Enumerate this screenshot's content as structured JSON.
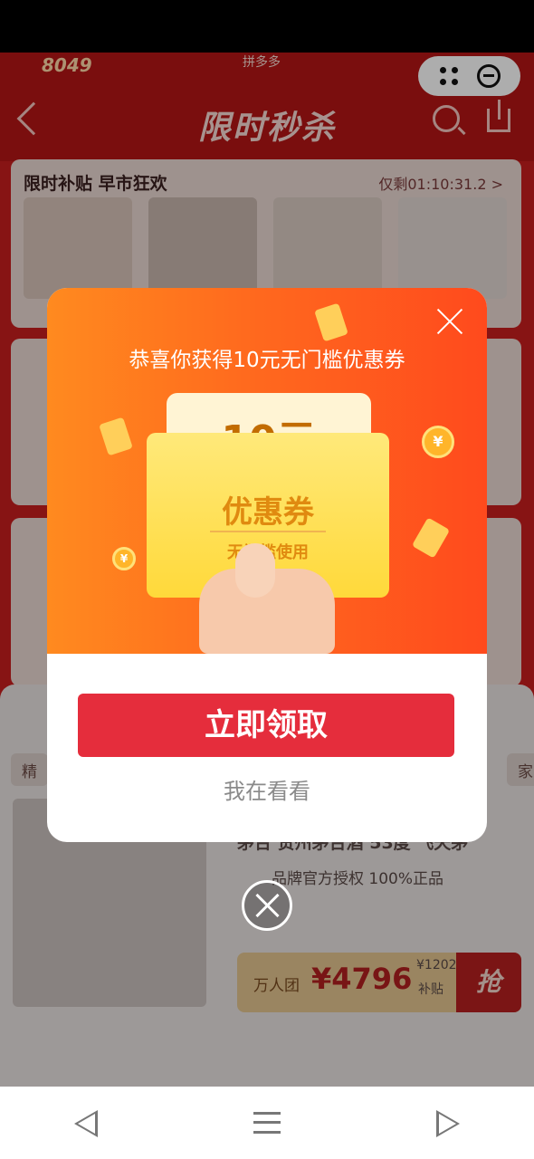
{
  "header": {
    "brand_mini": "8049",
    "app_name": "拼多多",
    "title": "限时秒杀"
  },
  "flash_sale": {
    "title": "限时补贴  早市狂欢",
    "countdown": "仅剩01:10:31.2 >"
  },
  "category_tabs": [
    "精",
    "家"
  ],
  "featured_product": {
    "title": "茅台 贵州茅台酒 53度 飞天茅",
    "tag": "品牌官方授权  100%正品",
    "price_label": "万人团",
    "price": "¥4796",
    "original_price": "¥1202",
    "subsidy": "补贴",
    "grab_label": "抢"
  },
  "modal": {
    "heading": "恭喜你获得10元无门槛优惠券",
    "coupon_amount": "10元",
    "coupon_label": "优惠券",
    "coupon_sub": "无门槛使用",
    "claim_button": "立即领取",
    "later_link": "我在看看",
    "coin_symbol": "¥"
  },
  "colors": {
    "brand_red": "#e52d3c",
    "modal_orange": "#ff6a1e",
    "coupon_yellow": "#ffd93a"
  }
}
